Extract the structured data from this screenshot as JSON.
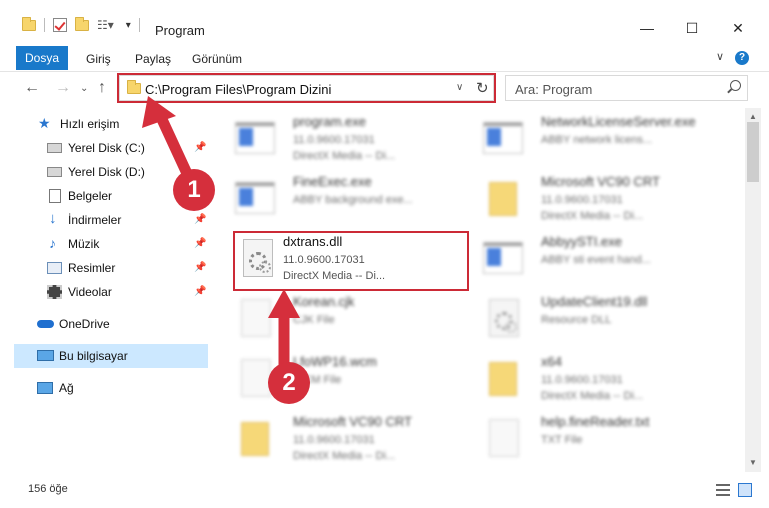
{
  "window": {
    "title": "Program",
    "minimize": "—",
    "maximize": "☐",
    "close": "✕"
  },
  "ribbon": {
    "tabs": [
      "Dosya",
      "Giriş",
      "Paylaş",
      "Görünüm"
    ],
    "help": "?"
  },
  "nav": {
    "address": "C:\\Program Files\\Program Dizini",
    "search_placeholder": "Ara: Program"
  },
  "sidebar": {
    "items": [
      {
        "label": "Hızlı erişim",
        "icon": "star-icon"
      },
      {
        "label": "Yerel Disk (C:)",
        "icon": "drive-icon"
      },
      {
        "label": "Yerel Disk (D:)",
        "icon": "drive-icon"
      },
      {
        "label": "Belgeler",
        "icon": "documents-icon"
      },
      {
        "label": "İndirmeler",
        "icon": "download-icon"
      },
      {
        "label": "Müzik",
        "icon": "music-icon"
      },
      {
        "label": "Resimler",
        "icon": "pictures-icon"
      },
      {
        "label": "Videolar",
        "icon": "video-icon"
      },
      {
        "label": "OneDrive",
        "icon": "cloud-icon"
      },
      {
        "label": "Bu bilgisayar",
        "icon": "computer-icon"
      },
      {
        "label": "Ağ",
        "icon": "network-icon"
      }
    ]
  },
  "files": {
    "left": [
      {
        "name": "program.exe",
        "line2": "11.0.9600.17031",
        "line3": "DirectX Media -- Di...",
        "icon": "setup-icon"
      },
      {
        "name": "FineExec.exe",
        "line2": "ABBY background exe...",
        "line3": "",
        "icon": "app-icon"
      },
      {
        "name": "dxtrans.dll",
        "line2": "11.0.9600.17031",
        "line3": "DirectX Media -- Di...",
        "icon": "dll-gear-icon"
      },
      {
        "name": "Korean.cjk",
        "line2": "CJK File",
        "line3": "",
        "icon": "file-icon"
      },
      {
        "name": "LfoWP16.wcm",
        "line2": "WCM File",
        "line3": "",
        "icon": "file-icon"
      },
      {
        "name": "Microsoft VC90 CRT",
        "line2": "11.0.9600.17031",
        "line3": "DirectX Media -- Di...",
        "icon": "folder-icon"
      }
    ],
    "right": [
      {
        "name": "NetworkLicenseServer.exe",
        "line2": "ABBY network licens...",
        "line3": "",
        "icon": "app-icon"
      },
      {
        "name": "Microsoft VC90 CRT",
        "line2": "11.0.9600.17031",
        "line3": "DirectX Media -- Di...",
        "icon": "folder-icon"
      },
      {
        "name": "AbbyySTI.exe",
        "line2": "ABBY sti event hand...",
        "line3": "",
        "icon": "app-icon"
      },
      {
        "name": "UpdateClient19.dll",
        "line2": "Resource DLL",
        "line3": "",
        "icon": "dll-gear-icon"
      },
      {
        "name": "x64",
        "line2": "11.0.9600.17031",
        "line3": "DirectX Media -- Di...",
        "icon": "folder-icon"
      },
      {
        "name": "help.fineReader.txt",
        "line2": "TXT File",
        "line3": "",
        "icon": "file-icon"
      }
    ]
  },
  "status": {
    "count": "156 öğe"
  },
  "annotations": {
    "badge1": "1",
    "badge2": "2",
    "color": "#cc2a36"
  }
}
